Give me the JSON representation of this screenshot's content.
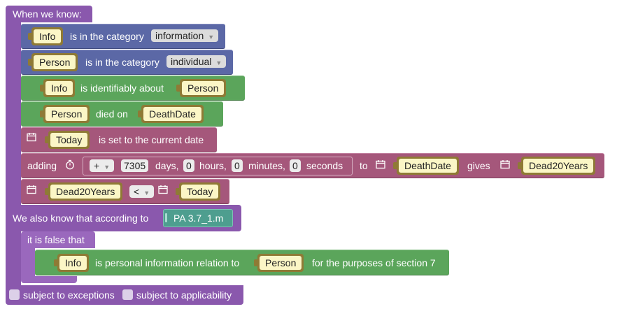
{
  "root": {
    "header": "When we know:",
    "also_know": "We also know that according to",
    "source": "PA 3.7_1.m",
    "footer": {
      "exceptions": "subject to exceptions",
      "applicability": "subject to applicability"
    }
  },
  "rows": {
    "r1": {
      "var": "Info",
      "text": "is in the category",
      "dropdown": "information"
    },
    "r2": {
      "var": "Person",
      "text": "is in the category",
      "dropdown": "individual"
    },
    "r3": {
      "var": "Info",
      "text": "is identifiably about",
      "var2": "Person"
    },
    "r4": {
      "var": "Person",
      "text": "died on",
      "var2": "DeathDate"
    },
    "r5": {
      "var": "Today",
      "text": "is set to the current date"
    },
    "r6": {
      "adding": "adding",
      "op": "+",
      "days_val": "7305",
      "days": "days,",
      "hours_val": "0",
      "hours": "hours,",
      "minutes_val": "0",
      "minutes": "minutes,",
      "seconds_val": "0",
      "seconds": "seconds",
      "to": "to",
      "var": "DeathDate",
      "gives": "gives",
      "var2": "Dead20Years"
    },
    "r7": {
      "var": "Dead20Years",
      "op": "<",
      "var2": "Today"
    }
  },
  "negation": {
    "label": "it is false that",
    "var": "Info",
    "text": "is personal information relation to",
    "var2": "Person",
    "tail": "for the purposes of section 7"
  },
  "colors": {
    "root": "#8a58ad",
    "category": "#5b68a6",
    "relation": "#5ba55b",
    "date": "#a5577b",
    "variable_border": "#8f7a35",
    "variable_fill": "#fbf6c6"
  },
  "icons": {
    "calendar": "calendar-icon",
    "stopwatch": "stopwatch-icon",
    "checkbox": "checkbox"
  }
}
